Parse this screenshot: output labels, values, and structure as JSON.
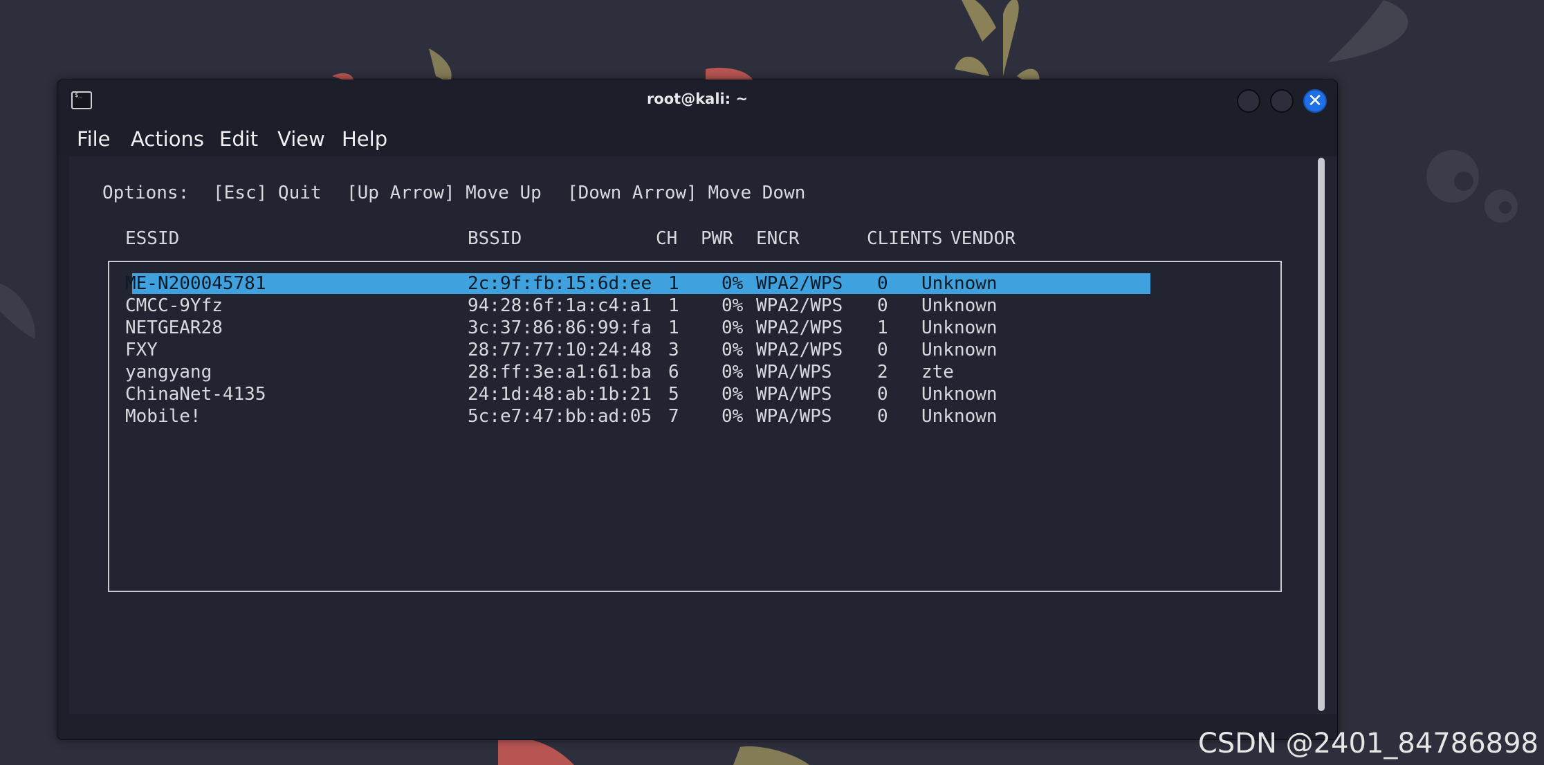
{
  "window": {
    "title": "root@kali: ~",
    "terminal_icon_glyph": "$_",
    "close_glyph": "✕"
  },
  "menu": [
    "File",
    "Actions",
    "Edit",
    "View",
    "Help"
  ],
  "options_line": {
    "label": "Options:",
    "items": [
      "[Esc] Quit",
      "[Up Arrow] Move Up",
      "[Down Arrow] Move Down"
    ]
  },
  "table": {
    "columns": [
      "ESSID",
      "BSSID",
      "CH",
      "PWR",
      "ENCR",
      "CLIENTS",
      "VENDOR"
    ],
    "rows": [
      {
        "essid": "ME-N200045781",
        "bssid": "2c:9f:fb:15:6d:ee",
        "ch": "1",
        "pwr": "0%",
        "encr": "WPA2/WPS",
        "clients": "0",
        "vendor": "Unknown",
        "selected": true
      },
      {
        "essid": "CMCC-9Yfz",
        "bssid": "94:28:6f:1a:c4:a1",
        "ch": "1",
        "pwr": "0%",
        "encr": "WPA2/WPS",
        "clients": "0",
        "vendor": "Unknown"
      },
      {
        "essid": "NETGEAR28",
        "bssid": "3c:37:86:86:99:fa",
        "ch": "1",
        "pwr": "0%",
        "encr": "WPA2/WPS",
        "clients": "1",
        "vendor": "Unknown"
      },
      {
        "essid": "FXY",
        "bssid": "28:77:77:10:24:48",
        "ch": "3",
        "pwr": "0%",
        "encr": "WPA2/WPS",
        "clients": "0",
        "vendor": "Unknown"
      },
      {
        "essid": "yangyang",
        "bssid": "28:ff:3e:a1:61:ba",
        "ch": "6",
        "pwr": "0%",
        "encr": "WPA/WPS",
        "clients": "2",
        "vendor": "zte"
      },
      {
        "essid": "ChinaNet-4135",
        "bssid": "24:1d:48:ab:1b:21",
        "ch": "5",
        "pwr": "0%",
        "encr": "WPA/WPS",
        "clients": "0",
        "vendor": "Unknown"
      },
      {
        "essid": "Mobile!",
        "bssid": "5c:e7:47:bb:ad:05",
        "ch": "7",
        "pwr": "0%",
        "encr": "WPA/WPS",
        "clients": "0",
        "vendor": "Unknown"
      }
    ]
  },
  "watermark": "CSDN @2401_84786898",
  "colors": {
    "selection": "#3fa2de",
    "close_button": "#1f6fe8",
    "terminal_bg": "#222432"
  }
}
